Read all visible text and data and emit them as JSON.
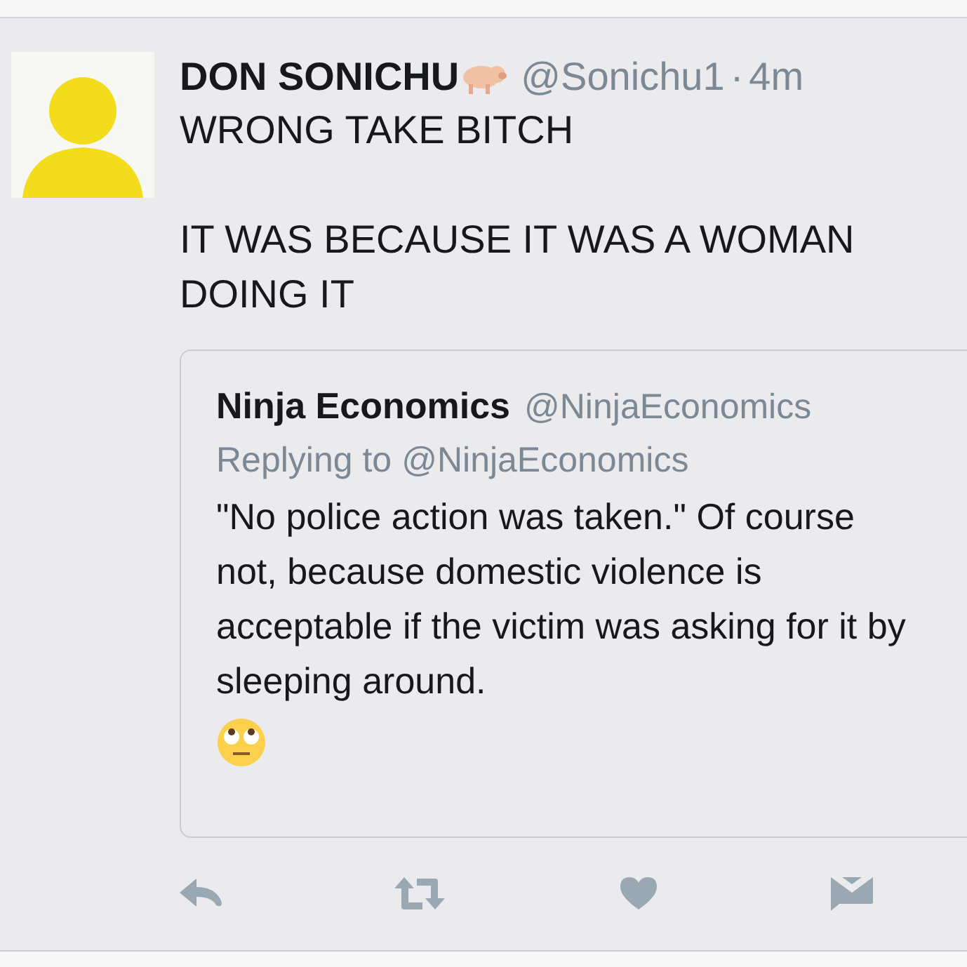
{
  "tweet": {
    "display_name": "DON SONICHU",
    "handle": "@Sonichu1",
    "separator": "·",
    "time": "4m",
    "paragraphs": [
      [
        "WRONG TAKE BITCH"
      ],
      [
        "IT WAS BECAUSE IT WAS A WOMAN",
        "DOING IT"
      ]
    ],
    "quoted_tweet": {
      "display_name": "Ninja Economics",
      "handle": "@NinjaEconomics",
      "reply_label": "Replying to",
      "reply_to": "@NinjaEconomics",
      "text": "\"No police action was taken.\" Of course not, because domestic violence is acceptable if the victim was asking for it by sleeping around."
    }
  }
}
